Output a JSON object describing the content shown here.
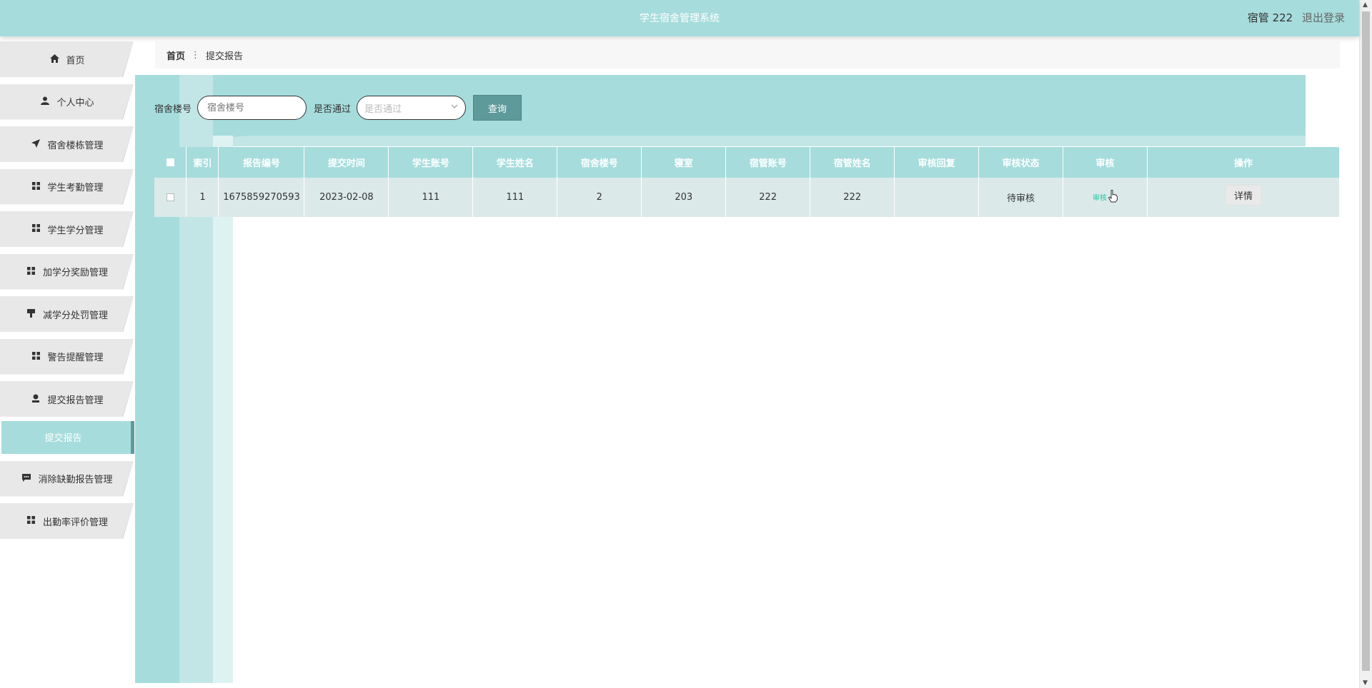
{
  "header": {
    "app_title": "学生宿舍管理系统",
    "user": "宿管 222",
    "logout": "退出登录"
  },
  "sidebar": {
    "items": [
      {
        "label": "首页",
        "icon": "home-icon"
      },
      {
        "label": "个人中心",
        "icon": "user-icon"
      },
      {
        "label": "宿舍楼栋管理",
        "icon": "send-icon"
      },
      {
        "label": "学生考勤管理",
        "icon": "grid-icon"
      },
      {
        "label": "学生学分管理",
        "icon": "grid-icon"
      },
      {
        "label": "加学分奖励管理",
        "icon": "grid-icon"
      },
      {
        "label": "减学分处罚管理",
        "icon": "stamp-icon"
      },
      {
        "label": "警告提醒管理",
        "icon": "grid-icon"
      },
      {
        "label": "提交报告管理",
        "icon": "person-icon"
      }
    ],
    "active_sub": "提交报告",
    "items_after": [
      {
        "label": "消除缺勤报告管理",
        "icon": "comment-icon"
      },
      {
        "label": "出勤率评价管理",
        "icon": "grid-icon"
      }
    ]
  },
  "breadcrumb": {
    "home": "首页",
    "current": "提交报告"
  },
  "filters": {
    "dorm_label": "宿舍楼号",
    "dorm_placeholder": "宿舍楼号",
    "pass_label": "是否通过",
    "pass_placeholder": "是否通过",
    "query_button": "查询"
  },
  "table": {
    "headers": [
      "索引",
      "报告编号",
      "提交时间",
      "学生账号",
      "学生姓名",
      "宿舍楼号",
      "寝室",
      "宿管账号",
      "宿管姓名",
      "审核回复",
      "审核状态",
      "审核",
      "操作"
    ],
    "rows": [
      {
        "index": "1",
        "report_no": "1675859270593",
        "submit_time": "2023-02-08",
        "student_account": "111",
        "student_name": "111",
        "dorm_no": "2",
        "room": "203",
        "admin_account": "222",
        "admin_name": "222",
        "audit_reply": "",
        "audit_status": "待审核",
        "audit_action": "审核",
        "detail_button": "详情"
      }
    ]
  },
  "colors": {
    "primary": "#a6dcdc",
    "accent_dark": "#5e9a9a",
    "row_bg": "#dbe9e9"
  }
}
